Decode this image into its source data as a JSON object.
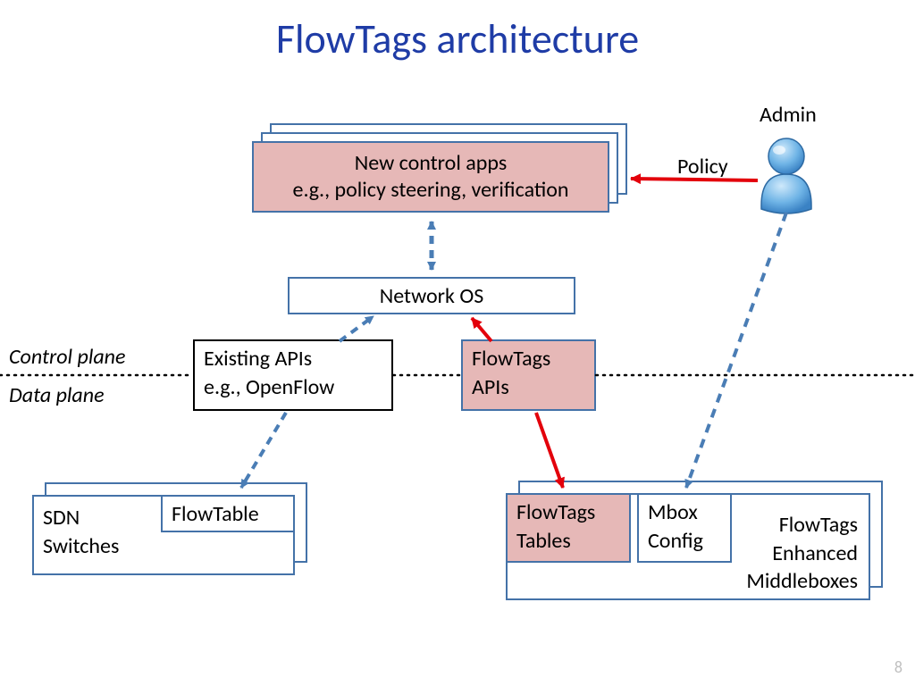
{
  "title": "FlowTags architecture",
  "admin_label": "Admin",
  "policy_label": "Policy",
  "control_plane_label": "Control plane",
  "data_plane_label": "Data plane",
  "new_apps": {
    "line1": "New control apps",
    "line2": "e.g., policy steering, verification"
  },
  "network_os": "Network OS",
  "existing_apis": {
    "line1": "Existing APIs",
    "line2": "e.g., OpenFlow"
  },
  "flowtags_apis": {
    "line1": "FlowTags",
    "line2": "APIs"
  },
  "sdn_switches": {
    "label": "SDN\nSwitches",
    "flowtable": "FlowTable"
  },
  "middleboxes": {
    "flowtags_tables": "FlowTags\nTables",
    "mbox_config": "Mbox\nConfig",
    "enhanced": "FlowTags\nEnhanced\nMiddleboxes"
  },
  "page_number": "8"
}
